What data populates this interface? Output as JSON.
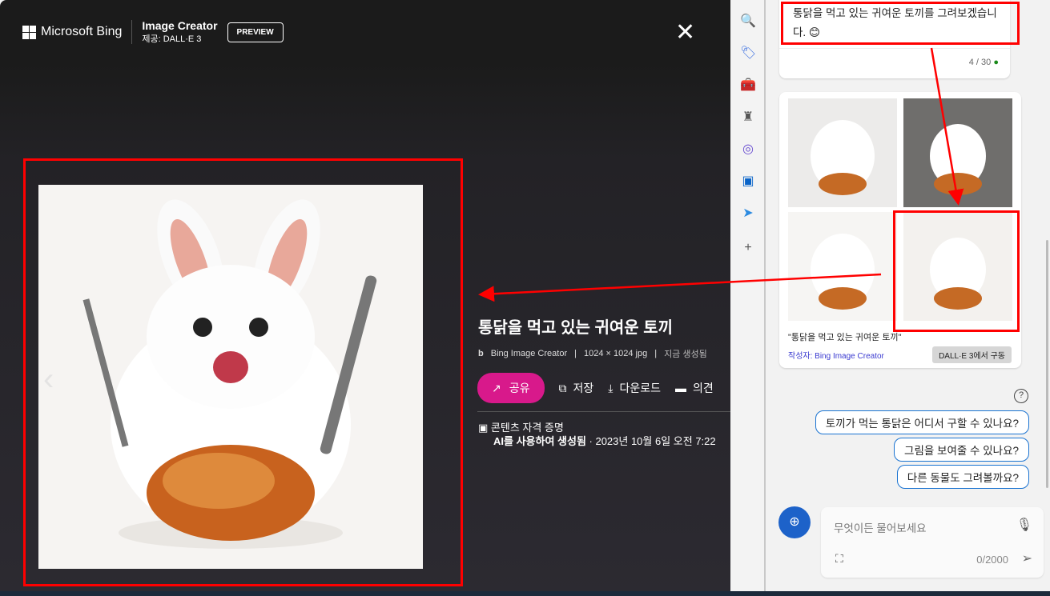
{
  "header": {
    "brand": "Microsoft Bing",
    "product": "Image Creator",
    "provider": "제공: DALL·E 3",
    "badge": "PREVIEW"
  },
  "viewer": {
    "title": "통닭을 먹고 있는 귀여운 토끼",
    "source": "Bing Image Creator",
    "dimensions": "1024 × 1024 jpg",
    "generated": "지금 생성됨",
    "actions": {
      "share": "공유",
      "save": "저장",
      "download": "다운로드",
      "feedback": "의견"
    },
    "credentials_title": "콘텐츠 자격 증명",
    "credentials_detail_bold": "AI를 사용하여 생성됨",
    "credentials_detail": " · 2023년 10월 6일 오전 7:22",
    "accent": "#d8198b"
  },
  "chat": {
    "message": "통닭을 먹고 있는 귀여운 토끼를 그려보겠습니다. 😊",
    "turn_count": "4 / 30",
    "image_caption": "\"통닭을 먹고 있는 귀여운 토끼\"",
    "author": "작성자: Bing Image Creator",
    "powered": "DALL·E 3에서 구동",
    "suggestions": [
      "토끼가 먹는 통닭은 어디서 구할 수 있나요?",
      "그림을 보여줄 수 있나요?",
      "다른 동물도 그려볼까요?"
    ],
    "input_placeholder": "무엇이든 물어보세요",
    "char_count": "0/2000"
  },
  "sidebar_icons": [
    "search-icon",
    "tag-icon",
    "toolbox-icon",
    "chess-icon",
    "copilot-icon",
    "outlook-icon",
    "send-icon",
    "plus-icon"
  ]
}
